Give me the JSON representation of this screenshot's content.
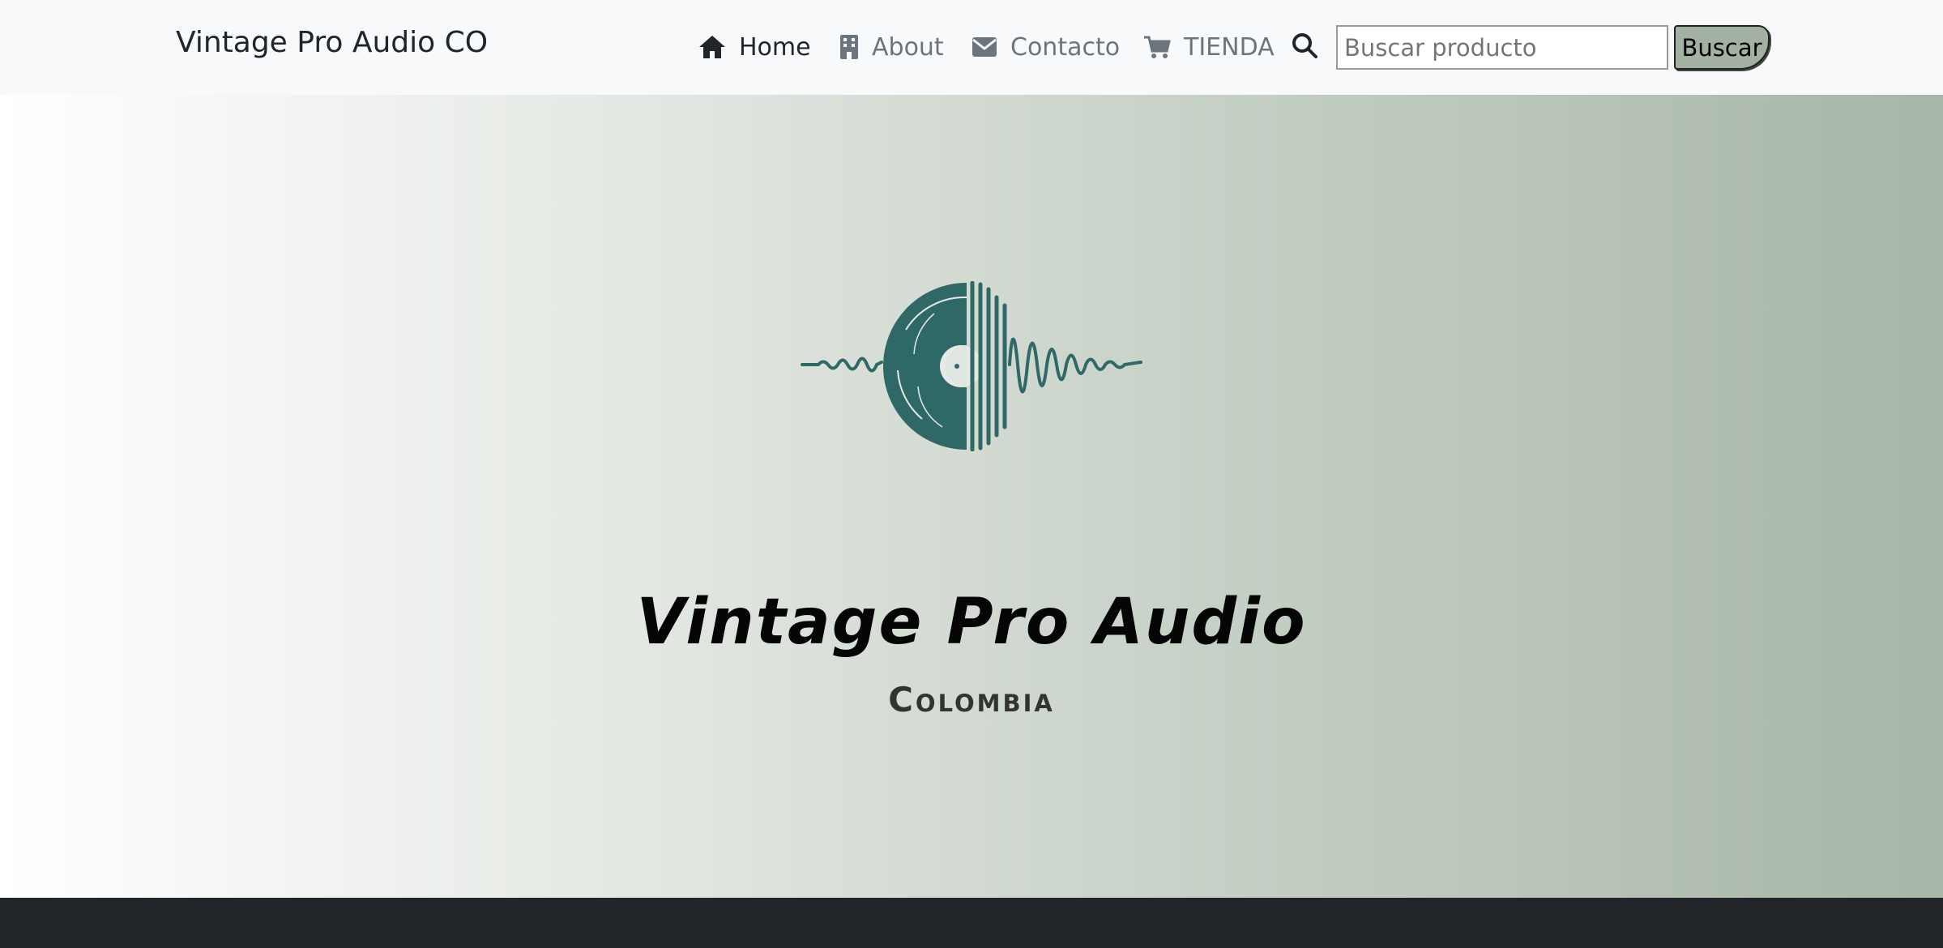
{
  "navbar": {
    "brand": "Vintage Pro Audio CO",
    "links": [
      {
        "label": "Home",
        "icon": "home-icon",
        "active": true
      },
      {
        "label": "About",
        "icon": "building-icon",
        "active": false
      },
      {
        "label": "Contacto",
        "icon": "envelope-icon",
        "active": false
      },
      {
        "label": "TIENDA",
        "icon": "cart-icon",
        "active": false
      }
    ],
    "search": {
      "icon": "search-icon",
      "placeholder": "Buscar producto",
      "value": "",
      "button_label": "Buscar"
    }
  },
  "hero": {
    "logo_icon": "vinyl-record-soundwave-logo",
    "title": "Vintage Pro Audio",
    "subtitle": "Colombia"
  },
  "colors": {
    "navbar_bg": "#f8f9fa",
    "logo_teal": "#2f6967",
    "hero_gradient_start": "#ffffff",
    "hero_gradient_end": "#a7b6a7",
    "footer_bg": "#212529",
    "button_bg": "#a3b1a3"
  }
}
